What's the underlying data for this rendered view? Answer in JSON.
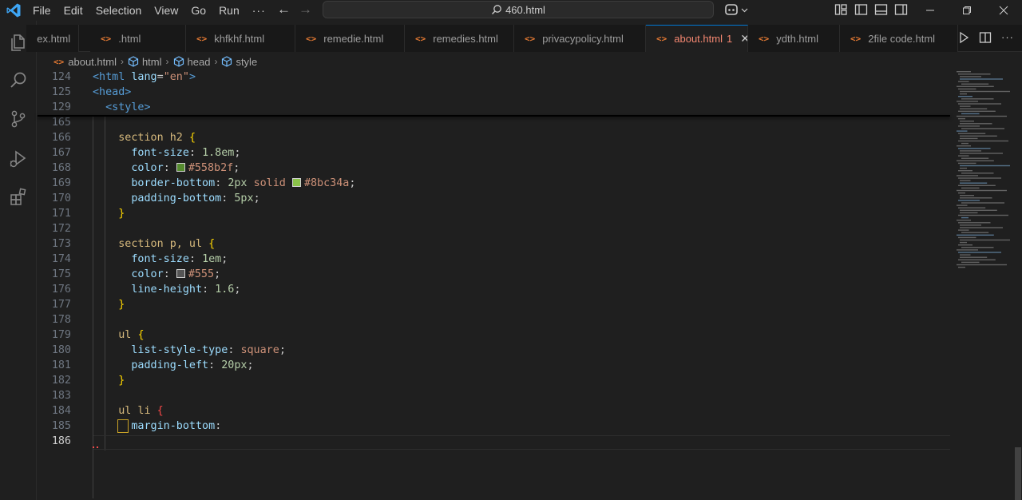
{
  "menu": [
    "File",
    "Edit",
    "Selection",
    "View",
    "Go",
    "Run"
  ],
  "menu_more": "···",
  "command_center": {
    "text": "460.html"
  },
  "tabs": [
    {
      "label": "ex.html",
      "active": false
    },
    {
      "label": ".html",
      "active": false
    },
    {
      "label": "khfkhf.html",
      "active": false
    },
    {
      "label": "remedie.html",
      "active": false
    },
    {
      "label": "remedies.html",
      "active": false
    },
    {
      "label": "privacypolicy.html",
      "active": false
    },
    {
      "label": "about.html",
      "badge": "1",
      "active": true
    },
    {
      "label": "ydth.html",
      "active": false
    },
    {
      "label": "2file code.html",
      "active": false
    }
  ],
  "tab_icon_glyph": "<>",
  "breadcrumb": [
    "about.html",
    "html",
    "head",
    "style"
  ],
  "sticky_lines": [
    {
      "n": "124",
      "tokens": [
        [
          "t-tag",
          "<html"
        ],
        [
          "t-plain",
          " "
        ],
        [
          "t-attr",
          "lang"
        ],
        [
          "t-plain",
          "="
        ],
        [
          "t-str",
          "\"en\""
        ],
        [
          "t-tag",
          ">"
        ]
      ]
    },
    {
      "n": "125",
      "tokens": [
        [
          "t-tag",
          "<head>"
        ]
      ]
    },
    {
      "n": "129",
      "tokens": [
        [
          "t-plain",
          "  "
        ],
        [
          "t-tag",
          "<style>"
        ]
      ]
    }
  ],
  "lines": [
    {
      "n": "165",
      "tokens": []
    },
    {
      "n": "166",
      "tokens": [
        [
          "t-plain",
          "    "
        ],
        [
          "t-sel",
          "section h2"
        ],
        [
          "t-plain",
          " "
        ],
        [
          "t-brace",
          "{"
        ]
      ]
    },
    {
      "n": "167",
      "tokens": [
        [
          "t-plain",
          "      "
        ],
        [
          "t-prop",
          "font-size"
        ],
        [
          "t-plain",
          ": "
        ],
        [
          "t-num",
          "1.8em"
        ],
        [
          "t-plain",
          ";"
        ]
      ]
    },
    {
      "n": "168",
      "tokens": [
        [
          "t-plain",
          "      "
        ],
        [
          "t-prop",
          "color"
        ],
        [
          "t-plain",
          ": "
        ],
        [
          "swatch",
          "#558b2f"
        ],
        [
          "t-val",
          "#558b2f"
        ],
        [
          "t-plain",
          ";"
        ]
      ]
    },
    {
      "n": "169",
      "tokens": [
        [
          "t-plain",
          "      "
        ],
        [
          "t-prop",
          "border-bottom"
        ],
        [
          "t-plain",
          ": "
        ],
        [
          "t-num",
          "2px"
        ],
        [
          "t-plain",
          " "
        ],
        [
          "t-val",
          "solid"
        ],
        [
          "t-plain",
          " "
        ],
        [
          "swatch",
          "#8bc34a"
        ],
        [
          "t-val",
          "#8bc34a"
        ],
        [
          "t-plain",
          ";"
        ]
      ]
    },
    {
      "n": "170",
      "tokens": [
        [
          "t-plain",
          "      "
        ],
        [
          "t-prop",
          "padding-bottom"
        ],
        [
          "t-plain",
          ": "
        ],
        [
          "t-num",
          "5px"
        ],
        [
          "t-plain",
          ";"
        ]
      ]
    },
    {
      "n": "171",
      "tokens": [
        [
          "t-plain",
          "    "
        ],
        [
          "t-brace",
          "}"
        ]
      ]
    },
    {
      "n": "172",
      "tokens": []
    },
    {
      "n": "173",
      "tokens": [
        [
          "t-plain",
          "    "
        ],
        [
          "t-sel",
          "section p, ul"
        ],
        [
          "t-plain",
          " "
        ],
        [
          "t-brace",
          "{"
        ]
      ]
    },
    {
      "n": "174",
      "tokens": [
        [
          "t-plain",
          "      "
        ],
        [
          "t-prop",
          "font-size"
        ],
        [
          "t-plain",
          ": "
        ],
        [
          "t-num",
          "1em"
        ],
        [
          "t-plain",
          ";"
        ]
      ]
    },
    {
      "n": "175",
      "tokens": [
        [
          "t-plain",
          "      "
        ],
        [
          "t-prop",
          "color"
        ],
        [
          "t-plain",
          ": "
        ],
        [
          "swatch",
          "#555555"
        ],
        [
          "t-val",
          "#555"
        ],
        [
          "t-plain",
          ";"
        ]
      ]
    },
    {
      "n": "176",
      "tokens": [
        [
          "t-plain",
          "      "
        ],
        [
          "t-prop",
          "line-height"
        ],
        [
          "t-plain",
          ": "
        ],
        [
          "t-num",
          "1.6"
        ],
        [
          "t-plain",
          ";"
        ]
      ]
    },
    {
      "n": "177",
      "tokens": [
        [
          "t-plain",
          "    "
        ],
        [
          "t-brace",
          "}"
        ]
      ]
    },
    {
      "n": "178",
      "tokens": []
    },
    {
      "n": "179",
      "tokens": [
        [
          "t-plain",
          "    "
        ],
        [
          "t-sel",
          "ul"
        ],
        [
          "t-plain",
          " "
        ],
        [
          "t-brace",
          "{"
        ]
      ]
    },
    {
      "n": "180",
      "tokens": [
        [
          "t-plain",
          "      "
        ],
        [
          "t-prop",
          "list-style-type"
        ],
        [
          "t-plain",
          ": "
        ],
        [
          "t-val",
          "square"
        ],
        [
          "t-plain",
          ";"
        ]
      ]
    },
    {
      "n": "181",
      "tokens": [
        [
          "t-plain",
          "      "
        ],
        [
          "t-prop",
          "padding-left"
        ],
        [
          "t-plain",
          ": "
        ],
        [
          "t-num",
          "20px"
        ],
        [
          "t-plain",
          ";"
        ]
      ]
    },
    {
      "n": "182",
      "tokens": [
        [
          "t-plain",
          "    "
        ],
        [
          "t-brace",
          "}"
        ]
      ]
    },
    {
      "n": "183",
      "tokens": []
    },
    {
      "n": "184",
      "tokens": [
        [
          "t-plain",
          "    "
        ],
        [
          "t-sel",
          "ul li"
        ],
        [
          "t-plain",
          " "
        ],
        [
          "t-brace-err",
          "{"
        ]
      ]
    },
    {
      "n": "185",
      "tokens": [
        [
          "t-plain",
          "      "
        ],
        [
          "t-prop",
          "margin-bottom"
        ],
        [
          "t-plain",
          ":"
        ]
      ]
    },
    {
      "n": "186",
      "tokens": [],
      "current": true
    }
  ],
  "colors": {
    "accent": "#0078d4",
    "active_tab_text": "#f48771",
    "tab_icon": "#e37933"
  }
}
